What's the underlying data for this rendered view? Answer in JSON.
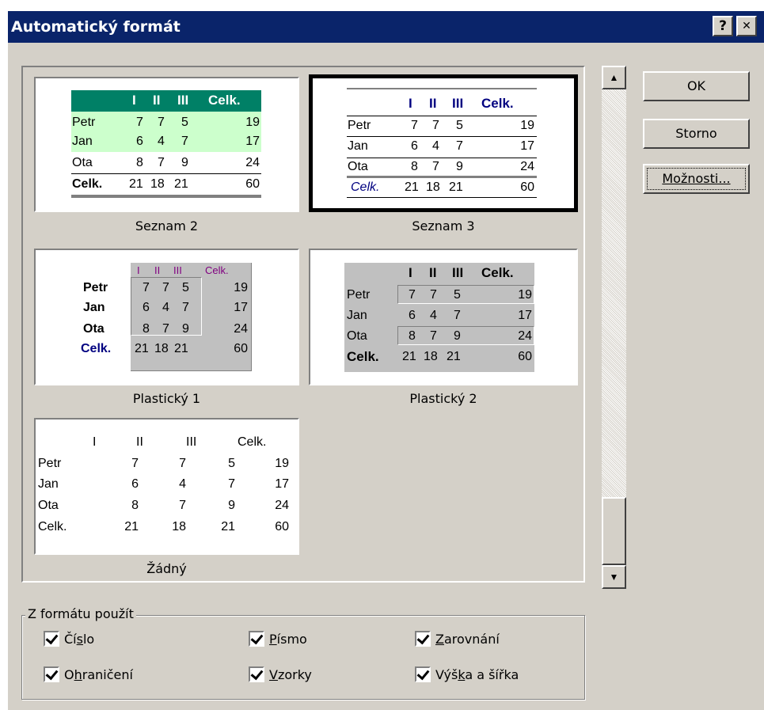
{
  "title": "Automatický formát",
  "title_buttons": {
    "help": "?",
    "close": "✕"
  },
  "buttons": {
    "ok": "OK",
    "cancel": "Storno",
    "options": "Možnosti..."
  },
  "formats": [
    {
      "name": "Seznam 2",
      "header": [
        "",
        "I",
        "II",
        "III",
        "Celk."
      ],
      "rows": [
        [
          "Petr",
          "7",
          "7",
          "5",
          "19"
        ],
        [
          "Jan",
          "6",
          "4",
          "7",
          "17"
        ],
        [
          "Ota",
          "8",
          "7",
          "9",
          "24"
        ],
        [
          "Celk.",
          "21",
          "18",
          "21",
          "60"
        ]
      ]
    },
    {
      "name": "Seznam 3",
      "header": [
        "",
        "I",
        "II",
        "III",
        "Celk."
      ],
      "rows": [
        [
          "Petr",
          "7",
          "7",
          "5",
          "19"
        ],
        [
          "Jan",
          "6",
          "4",
          "7",
          "17"
        ],
        [
          "Ota",
          "8",
          "7",
          "9",
          "24"
        ],
        [
          "Celk.",
          "21",
          "18",
          "21",
          "60"
        ]
      ]
    },
    {
      "name": "Plastický 1",
      "header": [
        "",
        "I",
        "II",
        "III",
        "Celk."
      ],
      "rows": [
        [
          "Petr",
          "7",
          "7",
          "5",
          "19"
        ],
        [
          "Jan",
          "6",
          "4",
          "7",
          "17"
        ],
        [
          "Ota",
          "8",
          "7",
          "9",
          "24"
        ],
        [
          "Celk.",
          "21",
          "18",
          "21",
          "60"
        ]
      ]
    },
    {
      "name": "Plastický 2",
      "header": [
        "",
        "I",
        "II",
        "III",
        "Celk."
      ],
      "rows": [
        [
          "Petr",
          "7",
          "7",
          "5",
          "19"
        ],
        [
          "Jan",
          "6",
          "4",
          "7",
          "17"
        ],
        [
          "Ota",
          "8",
          "7",
          "9",
          "24"
        ],
        [
          "Celk.",
          "21",
          "18",
          "21",
          "60"
        ]
      ]
    },
    {
      "name": "Žádný",
      "header": [
        "",
        "I",
        "II",
        "III",
        "Celk."
      ],
      "rows": [
        [
          "Petr",
          "7",
          "7",
          "5",
          "19"
        ],
        [
          "Jan",
          "6",
          "4",
          "7",
          "17"
        ],
        [
          "Ota",
          "8",
          "7",
          "9",
          "24"
        ],
        [
          "Celk.",
          "21",
          "18",
          "21",
          "60"
        ]
      ]
    }
  ],
  "selected": "Seznam 3",
  "apply_group": {
    "label": "Z formátu použít",
    "options": [
      {
        "pre": "Čí",
        "key": "s",
        "post": "lo",
        "checked": true
      },
      {
        "pre": "",
        "key": "P",
        "post": "ísmo",
        "checked": true
      },
      {
        "pre": "",
        "key": "Z",
        "post": "arovnání",
        "checked": true
      },
      {
        "pre": "O",
        "key": "h",
        "post": "raničení",
        "checked": true
      },
      {
        "pre": "",
        "key": "V",
        "post": "zorky",
        "checked": true
      },
      {
        "pre": "Výš",
        "key": "k",
        "post": "a a šířka",
        "checked": true
      }
    ]
  },
  "colors": {
    "titlebar": "#0a246a",
    "seznam2_header": "#008066",
    "seznam2_band": "#ccffcc",
    "navy": "#000080",
    "purple": "#800080",
    "face": "#d4d0c8"
  }
}
